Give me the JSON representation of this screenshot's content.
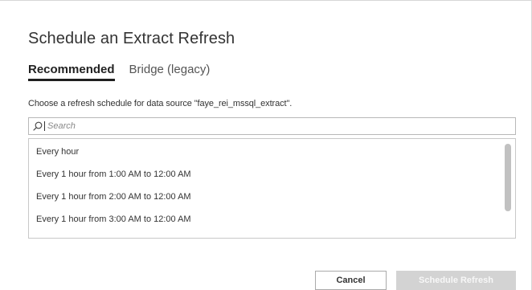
{
  "dialog": {
    "title": "Schedule an Extract Refresh",
    "tabs": [
      {
        "label": "Recommended",
        "active": true
      },
      {
        "label": "Bridge (legacy)",
        "active": false
      }
    ],
    "instruction": "Choose a refresh schedule for data source \"faye_rei_mssql_extract\".",
    "search": {
      "placeholder": "Search",
      "value": ""
    },
    "schedules": [
      "Every hour",
      "Every 1 hour from 1:00 AM to 12:00 AM",
      "Every 1 hour from 2:00 AM to 12:00 AM",
      "Every 1 hour from 3:00 AM to 12:00 AM"
    ],
    "buttons": {
      "cancel": "Cancel",
      "schedule_refresh": "Schedule Refresh",
      "schedule_refresh_enabled": false
    },
    "icons": {
      "search": "search-icon"
    },
    "colors": {
      "primary_disabled": "#d3d3d3",
      "active_tab_underline": "#1f1f1f"
    }
  }
}
